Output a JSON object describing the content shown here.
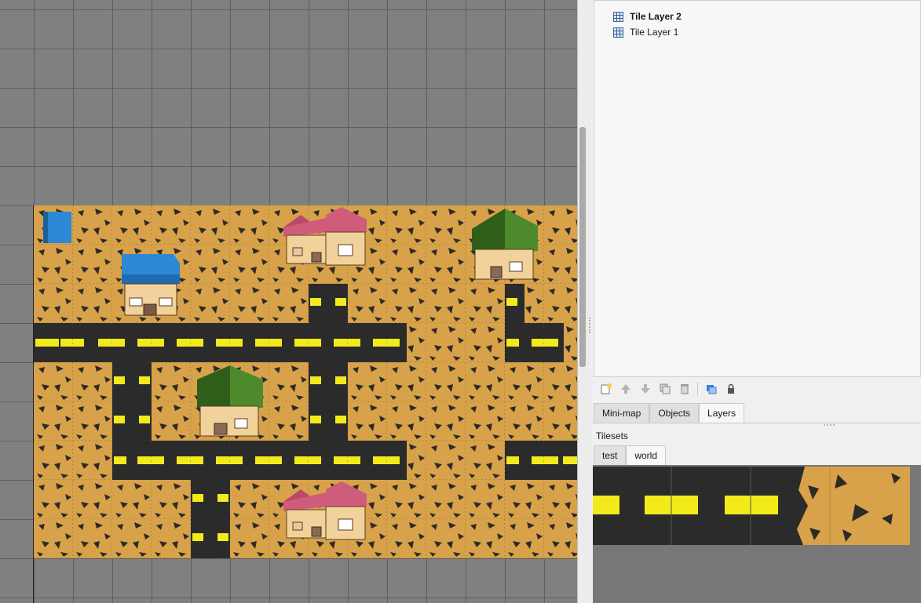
{
  "layers_panel": {
    "layers": [
      {
        "name": "Tile Layer 2",
        "selected": true
      },
      {
        "name": "Tile Layer 1",
        "selected": false
      }
    ],
    "toolbar_icons": [
      "new-layer-icon",
      "raise-layer-icon",
      "lower-layer-icon",
      "duplicate-layer-icon",
      "delete-layer-icon",
      "show-hide-other-layers-icon",
      "lock-layer-icon"
    ]
  },
  "dock_tabs": [
    {
      "label": "Mini-map",
      "active": false
    },
    {
      "label": "Objects",
      "active": false
    },
    {
      "label": "Layers",
      "active": true
    }
  ],
  "tilesets": {
    "title": "Tilesets",
    "tabs": [
      {
        "label": "test",
        "active": false
      },
      {
        "label": "world",
        "active": true
      }
    ]
  },
  "colors": {
    "dirt": "#d7a24a",
    "rock": "#2e2a26",
    "road": "#2b2b2b",
    "lane": "#f2ea1b",
    "roof_blue": "#2d88d6",
    "roof_pink": "#cf5c7a",
    "roof_green": "#4c8a2c",
    "canvas_bg": "#808080"
  }
}
